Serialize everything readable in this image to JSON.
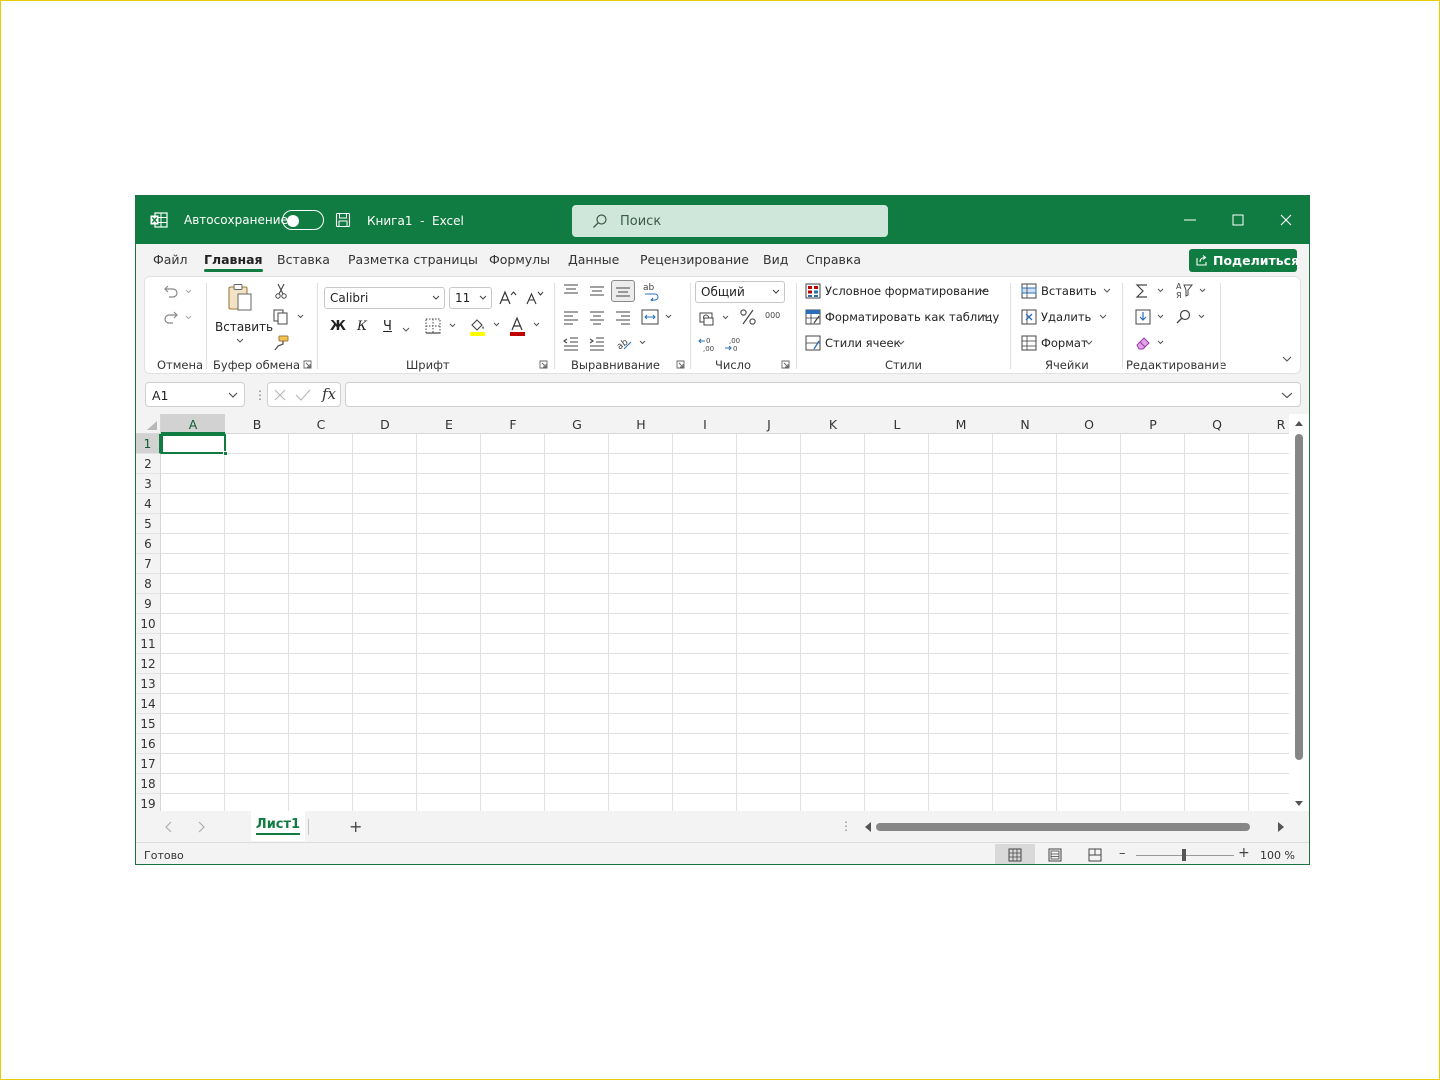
{
  "titlebar": {
    "autosave_label": "Автосохранение",
    "document_title": "Книга1  -  Excel",
    "search_placeholder": "Поиск",
    "accent_color": "#107c41"
  },
  "menu": {
    "items": [
      "Файл",
      "Главная",
      "Вставка",
      "Разметка страницы",
      "Формулы",
      "Данные",
      "Рецензирование",
      "Вид",
      "Справка"
    ],
    "active": "Главная",
    "share_label": "Поделиться"
  },
  "ribbon": {
    "groups": {
      "undo": "Отмена",
      "clipboard": "Буфер обмена",
      "font": "Шрифт",
      "alignment": "Выравнивание",
      "number": "Число",
      "styles": "Стили",
      "cells": "Ячейки",
      "editing": "Редактирование"
    },
    "paste_label": "Вставить",
    "font_name": "Calibri",
    "font_size": "11",
    "bold": "Ж",
    "italic": "К",
    "underline": "Ч",
    "number_format": "Общий",
    "conditional_formatting": "Условное форматирование",
    "format_as_table": "Форматировать как таблицу",
    "cell_styles": "Стили ячеек",
    "insert_cells": "Вставить",
    "delete_cells": "Удалить",
    "format_cells": "Формат",
    "font_color": "#c00000",
    "highlight_color": "#ffff00"
  },
  "formula_bar": {
    "name_box": "A1",
    "fx_label": "fx",
    "formula": ""
  },
  "grid": {
    "columns": [
      "A",
      "B",
      "C",
      "D",
      "E",
      "F",
      "G",
      "H",
      "I",
      "J",
      "K",
      "L",
      "M",
      "N",
      "O",
      "P",
      "Q",
      "R"
    ],
    "rows": [
      "1",
      "2",
      "3",
      "4",
      "5",
      "6",
      "7",
      "8",
      "9",
      "10",
      "11",
      "12",
      "13",
      "14",
      "15",
      "16",
      "17",
      "18",
      "19"
    ],
    "selected_cell": "A1"
  },
  "sheets": {
    "tabs": [
      "Лист1"
    ],
    "active": "Лист1"
  },
  "status": {
    "ready": "Готово",
    "zoom": "100 %"
  }
}
